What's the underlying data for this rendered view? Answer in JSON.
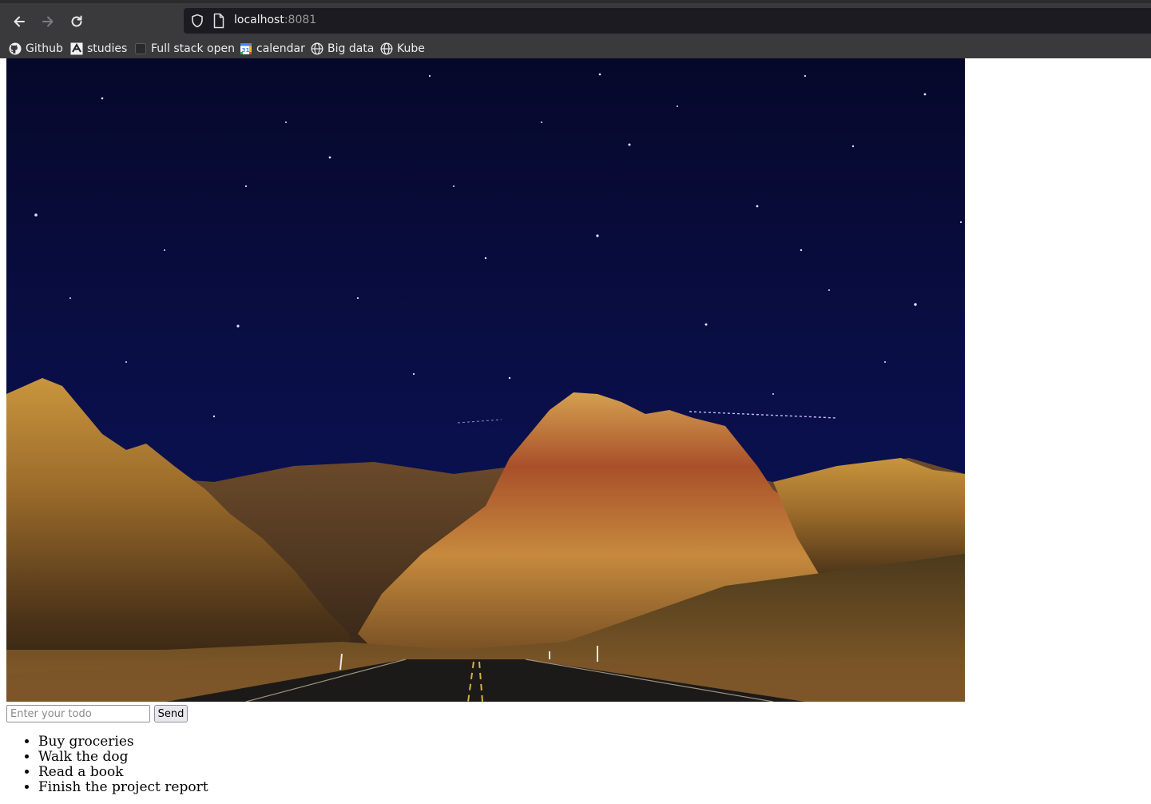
{
  "browser": {
    "url_host": "localhost",
    "url_port": ":8081",
    "bookmarks": [
      {
        "label": "Github",
        "icon": "github-icon"
      },
      {
        "label": "studies",
        "icon": "studies-icon"
      },
      {
        "label": "Full stack open",
        "icon": "blank-page-icon"
      },
      {
        "label": "calendar",
        "icon": "calendar-icon"
      },
      {
        "label": "Big data",
        "icon": "globe-icon"
      },
      {
        "label": "Kube",
        "icon": "globe-icon"
      }
    ]
  },
  "page": {
    "hero_image": "night-sky-mountains-road",
    "input": {
      "placeholder": "Enter your todo",
      "value": ""
    },
    "send_label": "Send",
    "todos": [
      "Buy groceries",
      "Walk the dog",
      "Read a book",
      "Finish the project report"
    ]
  }
}
